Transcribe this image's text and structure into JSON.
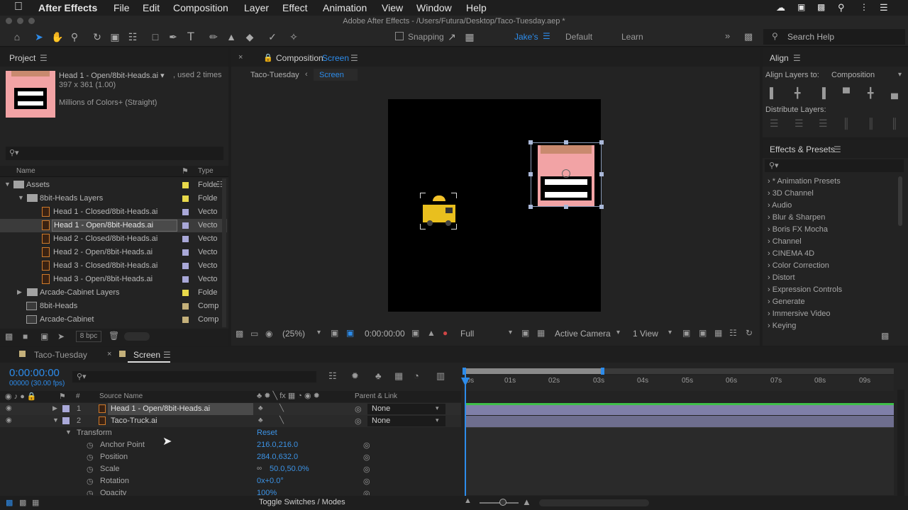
{
  "menubar": {
    "app": "After Effects",
    "items": [
      "File",
      "Edit",
      "Composition",
      "Layer",
      "Effect",
      "Animation",
      "View",
      "Window",
      "Help"
    ]
  },
  "titlebar": {
    "text": "Adobe After Effects - /Users/Futura/Desktop/Taco-Tuesday.aep *"
  },
  "toolbar": {
    "snapping": "Snapping",
    "workspaces": [
      "Jake's",
      "Default",
      "Learn"
    ],
    "search": "Search Help"
  },
  "project": {
    "title": "Project",
    "selected_name": "Head 1 - Open/8bit-Heads.ai",
    "used": ", used 2 times",
    "dims": "397 x 361 (1.00)",
    "colors": "Millions of Colors+ (Straight)",
    "col_name": "Name",
    "col_type": "Type",
    "bpc": "8 bpc",
    "items": [
      {
        "name": "Assets",
        "type": "Folde"
      },
      {
        "name": "8bit-Heads Layers",
        "type": "Folde"
      },
      {
        "name": "Head 1 - Closed/8bit-Heads.ai",
        "type": "Vecto"
      },
      {
        "name": "Head 1 - Open/8bit-Heads.ai",
        "type": "Vecto"
      },
      {
        "name": "Head 2 - Closed/8bit-Heads.ai",
        "type": "Vecto"
      },
      {
        "name": "Head 2 - Open/8bit-Heads.ai",
        "type": "Vecto"
      },
      {
        "name": "Head 3 - Closed/8bit-Heads.ai",
        "type": "Vecto"
      },
      {
        "name": "Head 3 - Open/8bit-Heads.ai",
        "type": "Vecto"
      },
      {
        "name": "Arcade-Cabinet Layers",
        "type": "Folde"
      },
      {
        "name": "8bit-Heads",
        "type": "Comp"
      },
      {
        "name": "Arcade-Cabinet",
        "type": "Comp"
      }
    ]
  },
  "composition": {
    "tab_prefix": "Composition",
    "tab_name": "Screen",
    "crumb1": "Taco-Tuesday",
    "crumb2": "Screen",
    "zoom": "(25%)",
    "time": "0:00:00:00",
    "quality": "Full",
    "camera": "Active Camera",
    "views": "1 View"
  },
  "align": {
    "title": "Align",
    "align_to_label": "Align Layers to:",
    "align_to": "Composition",
    "distribute": "Distribute Layers:"
  },
  "effects": {
    "title": "Effects & Presets",
    "items": [
      "* Animation Presets",
      "3D Channel",
      "Audio",
      "Blur & Sharpen",
      "Boris FX Mocha",
      "Channel",
      "CINEMA 4D",
      "Color Correction",
      "Distort",
      "Expression Controls",
      "Generate",
      "Immersive Video",
      "Keying"
    ]
  },
  "timeline": {
    "tabs": [
      "Taco-Tuesday",
      "Screen"
    ],
    "timecode": "0:00:00:00",
    "fps": "00000 (30.00 fps)",
    "col_source": "Source Name",
    "col_num": "#",
    "col_parent": "Parent & Link",
    "layers": [
      {
        "num": "1",
        "name": "Head 1 - Open/8bit-Heads.ai",
        "parent": "None"
      },
      {
        "num": "2",
        "name": "Taco-Truck.ai",
        "parent": "None"
      }
    ],
    "transform": "Transform",
    "reset": "Reset",
    "props": [
      {
        "name": "Anchor Point",
        "value": "216.0,216.0"
      },
      {
        "name": "Position",
        "value": "284.0,632.0"
      },
      {
        "name": "Scale",
        "value": "50.0,50.0%"
      },
      {
        "name": "Rotation",
        "value": "0x+0.0°"
      },
      {
        "name": "Opacity",
        "value": "100%"
      }
    ],
    "ruler": [
      "00s",
      "01s",
      "02s",
      "03s",
      "04s",
      "05s",
      "06s",
      "07s",
      "08s",
      "09s"
    ],
    "toggle": "Toggle Switches / Modes"
  },
  "colors": {
    "accent": "#2d8ceb",
    "label_yellow": "#e8d94a",
    "label_lav": "#a9a8d8",
    "label_tan": "#c4b07a"
  }
}
